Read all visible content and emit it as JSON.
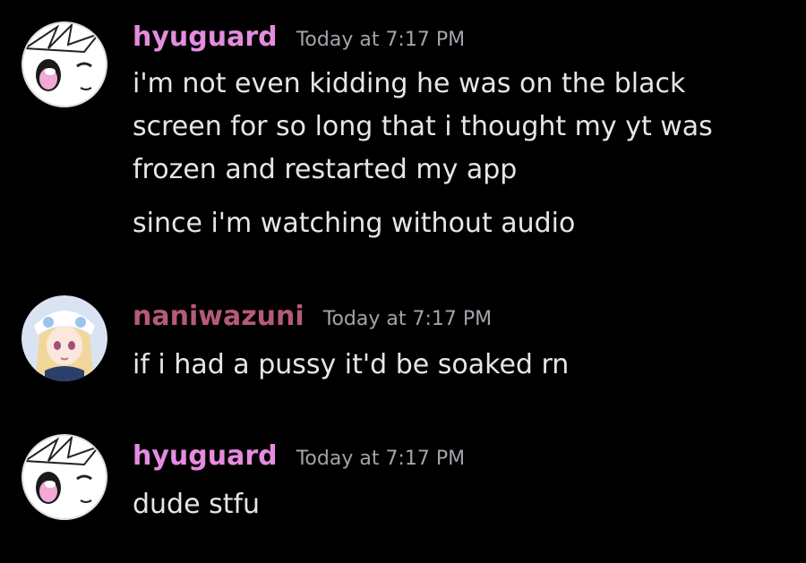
{
  "colors": {
    "background": "#000000",
    "text": "#e6e6e6",
    "timestamp": "#a3a3ab",
    "hyuguard_name": "#e58cdf",
    "naniwazuni_name": "#b55a78"
  },
  "messages": [
    {
      "username": "hyuguard",
      "timestamp": "Today at 7:17 PM",
      "avatar": "anime-face-avatar",
      "lines": [
        "i'm not even kidding he was on the black",
        "screen for so long that i thought my yt was",
        "frozen and restarted my app",
        "since i'm watching without audio"
      ]
    },
    {
      "username": "naniwazuni",
      "timestamp": "Today at 7:17 PM",
      "avatar": "anime-girl-avatar",
      "lines": [
        "if i had a pussy it'd be soaked rn"
      ]
    },
    {
      "username": "hyuguard",
      "timestamp": "Today at 7:17 PM",
      "avatar": "anime-face-avatar",
      "lines": [
        "dude stfu"
      ]
    }
  ]
}
